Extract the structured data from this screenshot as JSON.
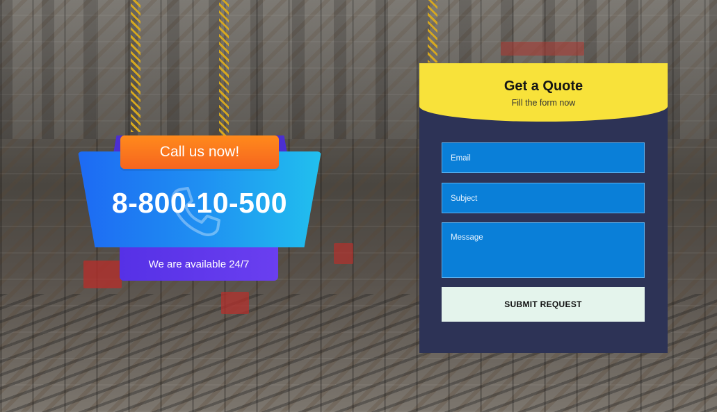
{
  "call": {
    "headline": "Call us now!",
    "phone": "8-800-10-500",
    "availability": "We are available 24/7"
  },
  "quote": {
    "title": "Get a Quote",
    "subtitle": "Fill the form now",
    "email_placeholder": "Email",
    "subject_placeholder": "Subject",
    "message_placeholder": "Message",
    "submit_label": "SUBMIT REQUEST"
  },
  "colors": {
    "quote_header": "#f8e23a",
    "quote_panel": "#2d3356",
    "field": "#0a7fd8",
    "submit_bg": "#e4f4ec",
    "call_top": "#f6651f",
    "call_bottom": "#5631e6"
  },
  "icons": {
    "phone_watermark": "phone-icon"
  }
}
